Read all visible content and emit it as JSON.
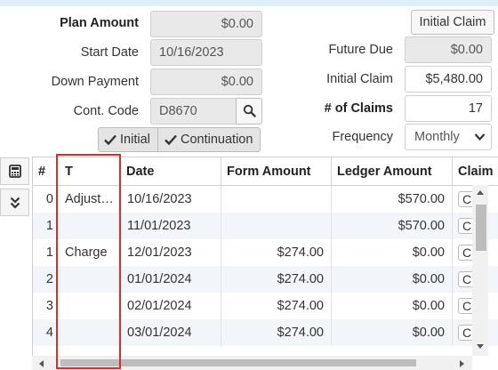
{
  "form": {
    "plan_amount_label": "Plan Amount",
    "plan_amount_value": "$0.00",
    "start_date_label": "Start Date",
    "start_date_value": "10/16/2023",
    "down_payment_label": "Down Payment",
    "down_payment_value": "$0.00",
    "cont_code_label": "Cont. Code",
    "cont_code_value": "D8670",
    "initial_claim_button": "Initial Claim",
    "future_due_label": "Future Due",
    "future_due_value": "$0.00",
    "initial_claim_label": "Initial Claim",
    "initial_claim_value": "$5,480.00",
    "num_claims_label": "# of Claims",
    "num_claims_value": "17",
    "frequency_label": "Frequency",
    "frequency_value": "Monthly",
    "toggle_initial": "Initial",
    "toggle_continuation": "Continuation"
  },
  "sidebar": {
    "calculator_icon": "calculator-icon",
    "expand_icon": "double-chevron-down-icon"
  },
  "grid": {
    "columns": [
      "#",
      "T",
      "Date",
      "Form Amount",
      "Ledger Amount",
      "Claim"
    ],
    "rows": [
      {
        "num": "0",
        "type": "Adjust…",
        "date": "10/16/2023",
        "form_amount": "",
        "ledger_amount": "$570.00",
        "claim": "C"
      },
      {
        "num": "1",
        "type": "",
        "date": "11/01/2023",
        "form_amount": "",
        "ledger_amount": "$570.00",
        "claim": "C"
      },
      {
        "num": "1",
        "type": "Charge",
        "date": "12/01/2023",
        "form_amount": "$274.00",
        "ledger_amount": "$0.00",
        "claim": "C"
      },
      {
        "num": "2",
        "type": "",
        "date": "01/01/2024",
        "form_amount": "$274.00",
        "ledger_amount": "$0.00",
        "claim": "C"
      },
      {
        "num": "3",
        "type": "",
        "date": "02/01/2024",
        "form_amount": "$274.00",
        "ledger_amount": "$0.00",
        "claim": "C"
      },
      {
        "num": "4",
        "type": "",
        "date": "03/01/2024",
        "form_amount": "$274.00",
        "ledger_amount": "$0.00",
        "claim": "C"
      }
    ]
  },
  "colors": {
    "readonly_bg": "#e9e9e9",
    "highlight": "#d32f2f",
    "row_alt": "#f2f6fa"
  }
}
